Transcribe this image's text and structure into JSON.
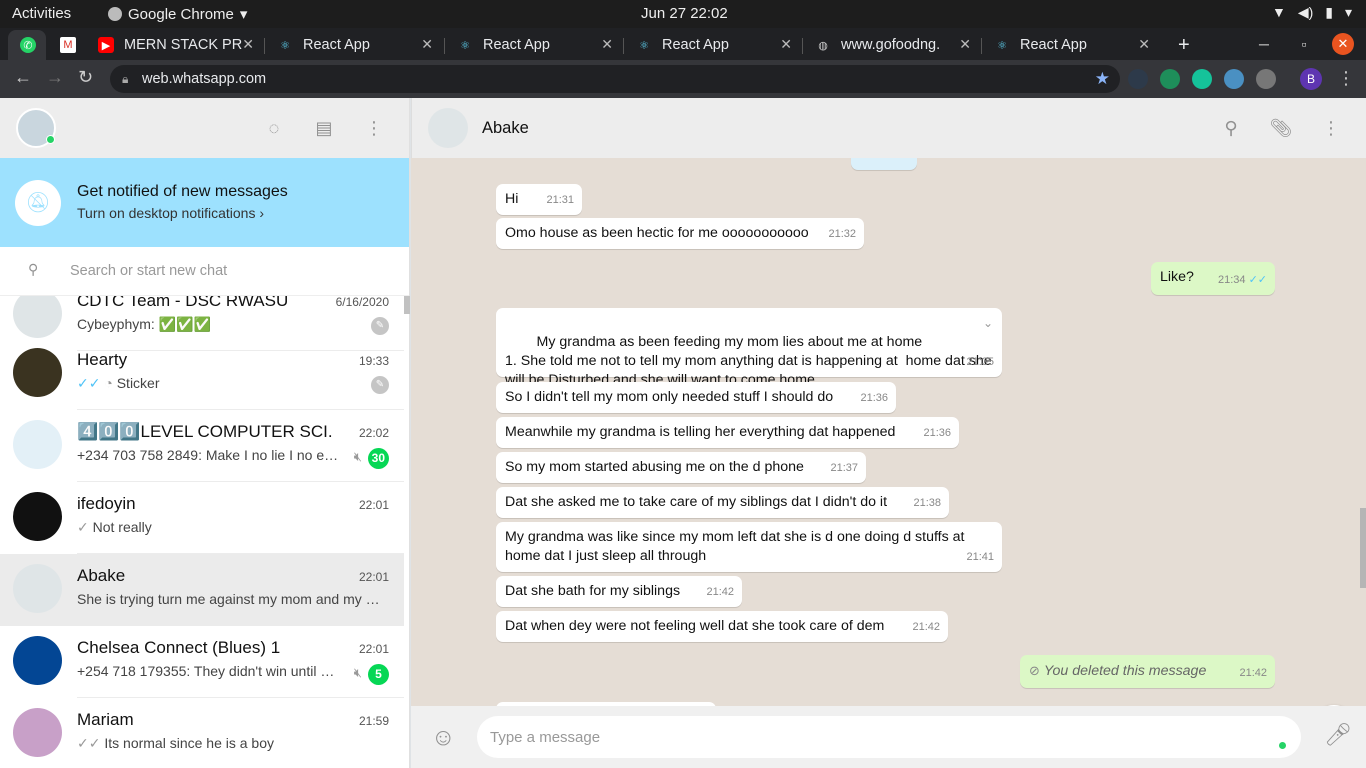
{
  "os": {
    "activities": "Activities",
    "app_name": "Google Chrome",
    "clock": "Jun 27  22:02"
  },
  "tabs": [
    {
      "label": "",
      "icon": "whatsapp-icon"
    },
    {
      "label": "",
      "icon": "gmail-icon"
    },
    {
      "label": "MERN STACK PRO",
      "icon": "youtube-icon"
    },
    {
      "label": "React App",
      "icon": "react-icon"
    },
    {
      "label": "React App",
      "icon": "react-icon"
    },
    {
      "label": "React App",
      "icon": "react-icon"
    },
    {
      "label": "www.gofoodng.",
      "icon": "globe-icon"
    },
    {
      "label": "React App",
      "icon": "react-icon"
    }
  ],
  "browser": {
    "url": "web.whatsapp.com",
    "profile_initial": "B"
  },
  "notification": {
    "title": "Get notified of new messages",
    "subtitle": "Turn on desktop notifications ›"
  },
  "search": {
    "placeholder": "Search or start new chat"
  },
  "chats": [
    {
      "name": "CDTC Team - DSC RWASU",
      "time": "6/16/2020",
      "preview": "Cybeyphym: ✅✅✅",
      "pinned": true
    },
    {
      "name": "Hearty",
      "time": "19:33",
      "preview": "Sticker",
      "pinned": true
    },
    {
      "name": "4️⃣0️⃣0️⃣LEVEL COMPUTER SCI.",
      "time": "22:02",
      "preview": "+234 703 758 2849: Make I no lie I no e…",
      "unread": "30",
      "muted": true
    },
    {
      "name": "ifedoyin",
      "time": "22:01",
      "preview": "Not really"
    },
    {
      "name": "Abake",
      "time": "22:01",
      "preview": "She is trying turn me against my mom and my …"
    },
    {
      "name": "Chelsea Connect (Blues) 1",
      "time": "22:01",
      "preview": "+254 718 179355: They didn't win until …",
      "unread": "5",
      "muted": true
    },
    {
      "name": "Mariam",
      "time": "21:59",
      "preview": "Its normal since he is a boy"
    }
  ],
  "conversation": {
    "contact": "Abake",
    "messages": [
      {
        "text": "Hi",
        "time": "21:31",
        "dir": "in"
      },
      {
        "text": "Omo house as been hectic for me ooooooooooo",
        "time": "21:32",
        "dir": "in"
      },
      {
        "text": "Like?",
        "time": "21:34",
        "dir": "out"
      },
      {
        "text": "My grandma as been feeding my mom lies about me at home\n1. She told me not to tell my mom anything dat is happening at  home dat she will be Disturbed and she will want to come home",
        "time": "21:35",
        "dir": "in"
      },
      {
        "text": "So I didn't tell my mom only needed stuff I should do",
        "time": "21:36",
        "dir": "in"
      },
      {
        "text": "Meanwhile my grandma is telling her everything dat happened",
        "time": "21:36",
        "dir": "in"
      },
      {
        "text": "So my mom started abusing me on the d phone",
        "time": "21:37",
        "dir": "in"
      },
      {
        "text": "Dat she asked me to take care of my siblings dat I didn't do it",
        "time": "21:38",
        "dir": "in"
      },
      {
        "text": "My grandma was like since my mom left dat she is d one doing d stuffs at home dat I just sleep all through",
        "time": "21:41",
        "dir": "in"
      },
      {
        "text": "Dat she bath for my siblings",
        "time": "21:42",
        "dir": "in"
      },
      {
        "text": "Dat when dey were not feeling well dat she took care of dem",
        "time": "21:42",
        "dir": "in"
      },
      {
        "text": "You deleted this message",
        "time": "21:42",
        "dir": "out",
        "deleted": true
      }
    ]
  },
  "composer": {
    "placeholder": "Type a message"
  }
}
